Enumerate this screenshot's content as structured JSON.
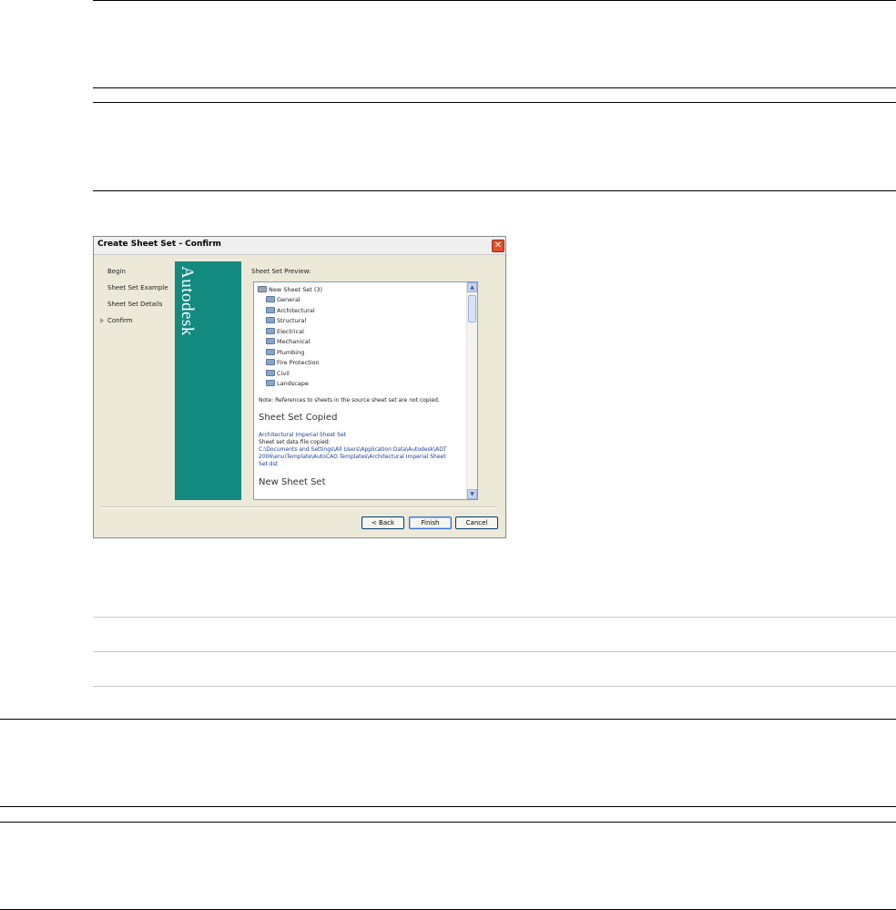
{
  "dialog": {
    "title": "Create Sheet Set - Confirm",
    "close_label": "✕",
    "nav": [
      {
        "label": "Begin"
      },
      {
        "label": "Sheet Set Example"
      },
      {
        "label": "Sheet Set Details"
      },
      {
        "label": "Confirm",
        "current": true
      }
    ],
    "brand": "Autodesk",
    "brand_color": "#128a80",
    "preview_label": "Sheet Set Preview:",
    "preview": {
      "root": "New Sheet Set (3)",
      "items": [
        "General",
        "Architectural",
        "Structural",
        "Electrical",
        "Mechanical",
        "Plumbing",
        "Fire Protection",
        "Civil",
        "Landscape"
      ],
      "note": "Note: References to sheets in the source sheet set are not copied.",
      "copied_heading": "Sheet Set Copied",
      "source_name": "Architectural Imperial Sheet Set",
      "data_file_label": "Sheet set data file copied:",
      "path_lines": [
        "C:\\Documents and Settings\\All Users\\Application Data\\Autodesk\\ADT",
        "2006\\enu\\Template\\AutoCAD Templates\\Architectural Imperial Sheet",
        "Set.dst"
      ],
      "new_heading": "New Sheet Set"
    },
    "buttons": {
      "back": "< Back",
      "finish": "Finish",
      "cancel": "Cancel"
    }
  }
}
